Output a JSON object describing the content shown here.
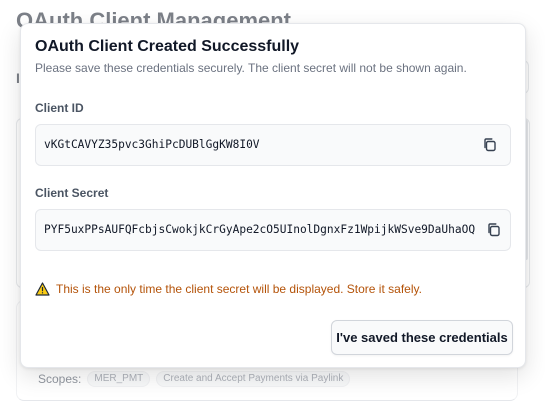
{
  "background": {
    "page_title": "OAuth Client Management",
    "section_letter": "I",
    "scopes_label": "Scopes:",
    "scope_badges": [
      "MER_PMT",
      "Create and Accept Payments via Paylink"
    ]
  },
  "modal": {
    "title": "OAuth Client Created Successfully",
    "subtitle": "Please save these credentials securely. The client secret will not be shown again.",
    "client_id_label": "Client ID",
    "client_id_value": "vKGtCAVYZ35pvc3GhiPcDUBlGgKW8I0V",
    "client_secret_label": "Client Secret",
    "client_secret_value": "PYF5uxPPsAUFQFcbjsCwokjkCrGyApe2cO5UInolDgnxFz1WpijkWSve9DaUhaOQ",
    "warning_text": "This is the only time the client secret will be displayed. Store it safely.",
    "confirm_button": "I've saved these credentials"
  },
  "icons": {
    "copy": "copy-icon",
    "warning": "warning-icon"
  },
  "colors": {
    "warning_text": "#b45309",
    "warning_icon_fill": "#facc15"
  }
}
